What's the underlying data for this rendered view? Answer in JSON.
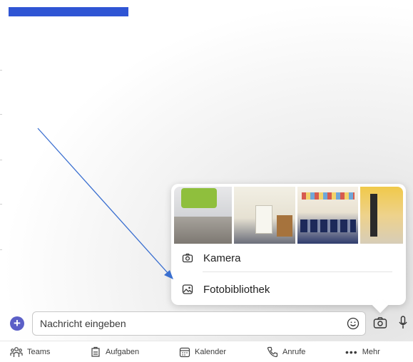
{
  "header": {
    "redacted_title": ""
  },
  "popup": {
    "thumbnails": [
      "photo-1",
      "photo-2",
      "photo-3",
      "photo-4"
    ],
    "options": [
      {
        "label": "Kamera",
        "icon": "camera-icon"
      },
      {
        "label": "Fotobibliothek",
        "icon": "photo-library-icon"
      }
    ]
  },
  "compose": {
    "placeholder": "Nachricht eingeben",
    "icons": [
      "plus-icon",
      "emoji-icon",
      "camera-icon",
      "microphone-icon"
    ],
    "plus_color": "#5b5fc7"
  },
  "nav": {
    "items": [
      {
        "label": "Teams",
        "icon": "teams-icon"
      },
      {
        "label": "Aufgaben",
        "icon": "tasks-icon"
      },
      {
        "label": "Kalender",
        "icon": "calendar-icon"
      },
      {
        "label": "Anrufe",
        "icon": "phone-icon"
      },
      {
        "label": "Mehr",
        "icon": "more-icon"
      }
    ]
  },
  "colors": {
    "accent": "#5b5fc7",
    "arrow": "#3a6fd0",
    "redaction": "#2f55d4"
  }
}
